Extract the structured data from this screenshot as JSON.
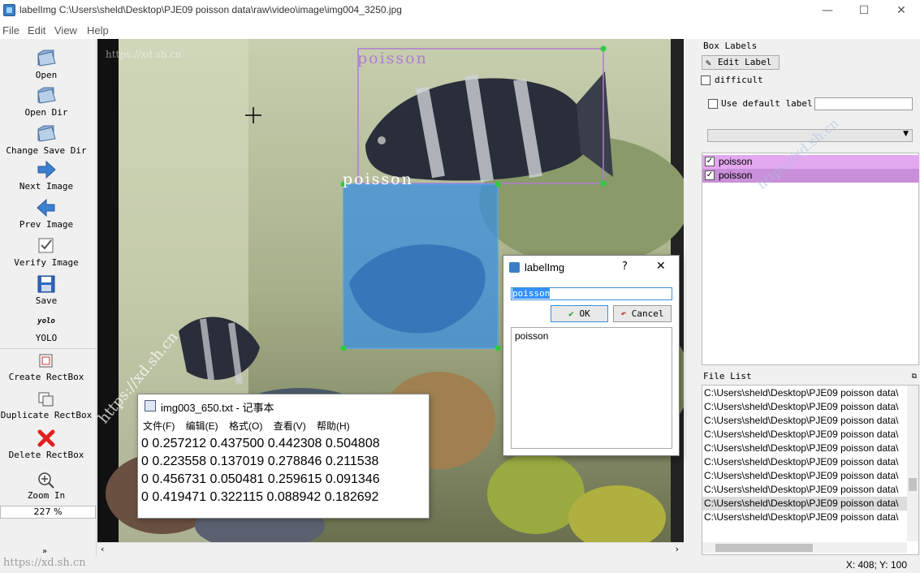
{
  "window": {
    "title": "labelImg C:\\Users\\sheld\\Desktop\\PJE09 poisson data\\raw\\video\\image\\img004_3250.jpg",
    "minimize": "—",
    "maximize": "☐",
    "close": "✕"
  },
  "menu": [
    "File",
    "Edit",
    "View",
    "Help"
  ],
  "toolbar": {
    "open": "Open",
    "open_dir": "Open Dir",
    "change_save_dir": "Change Save Dir",
    "next_image": "Next Image",
    "prev_image": "Prev Image",
    "verify_image": "Verify Image",
    "save": "Save",
    "yolo_icon_text": "yolo",
    "yolo": "YOLO",
    "create_rectbox": "Create RectBox",
    "duplicate_rectbox": "Duplicate RectBox",
    "delete_rectbox": "Delete RectBox",
    "zoom_in": "Zoom In",
    "zoom_value": "227 %"
  },
  "canvas": {
    "box_labels": [
      "poisson",
      "poisson"
    ]
  },
  "box_labels_panel": {
    "header": "Box Labels",
    "edit_label": "Edit Label",
    "difficult": "difficult",
    "use_default_label": "Use default label",
    "default_label_value": "",
    "labels": [
      {
        "name": "poisson",
        "checked": true,
        "color": "#e3a8f0"
      },
      {
        "name": "poisson",
        "checked": true,
        "color": "#c98fd8"
      }
    ]
  },
  "file_list_panel": {
    "header": "File List",
    "files": [
      "C:\\Users\\sheld\\Desktop\\PJE09 poisson data\\",
      "C:\\Users\\sheld\\Desktop\\PJE09 poisson data\\",
      "C:\\Users\\sheld\\Desktop\\PJE09 poisson data\\",
      "C:\\Users\\sheld\\Desktop\\PJE09 poisson data\\",
      "C:\\Users\\sheld\\Desktop\\PJE09 poisson data\\",
      "C:\\Users\\sheld\\Desktop\\PJE09 poisson data\\",
      "C:\\Users\\sheld\\Desktop\\PJE09 poisson data\\",
      "C:\\Users\\sheld\\Desktop\\PJE09 poisson data\\",
      "C:\\Users\\sheld\\Desktop\\PJE09 poisson data\\",
      "C:\\Users\\sheld\\Desktop\\PJE09 poisson data\\"
    ]
  },
  "dialog": {
    "title": "labelImg",
    "help": "?",
    "close": "✕",
    "input_value": "poisson",
    "ok": "OK",
    "cancel": "Cancel",
    "list": [
      "poisson"
    ]
  },
  "notepad": {
    "title": "img003_650.txt - 记事本",
    "menu": [
      "文件(F)",
      "编辑(E)",
      "格式(O)",
      "查看(V)",
      "帮助(H)"
    ],
    "lines": [
      "0 0.257212 0.437500 0.442308 0.504808",
      "0 0.223558 0.137019 0.278846 0.211538",
      "0 0.456731 0.050481 0.259615 0.091346",
      "0 0.419471 0.322115 0.088942 0.182692"
    ]
  },
  "status": {
    "coords": "X: 408; Y: 100"
  },
  "watermarks": [
    "https://xd.sh.cn",
    "https://xd.sh.cn",
    "https://xd.sh.cn",
    "https://xd.sh.cn"
  ],
  "colors": {
    "box1": "#b07cd0",
    "box2": "#3a8fe0",
    "handle": "#2ecc40",
    "label_row1": "#e3a8f0",
    "label_row2": "#c98fd8"
  }
}
